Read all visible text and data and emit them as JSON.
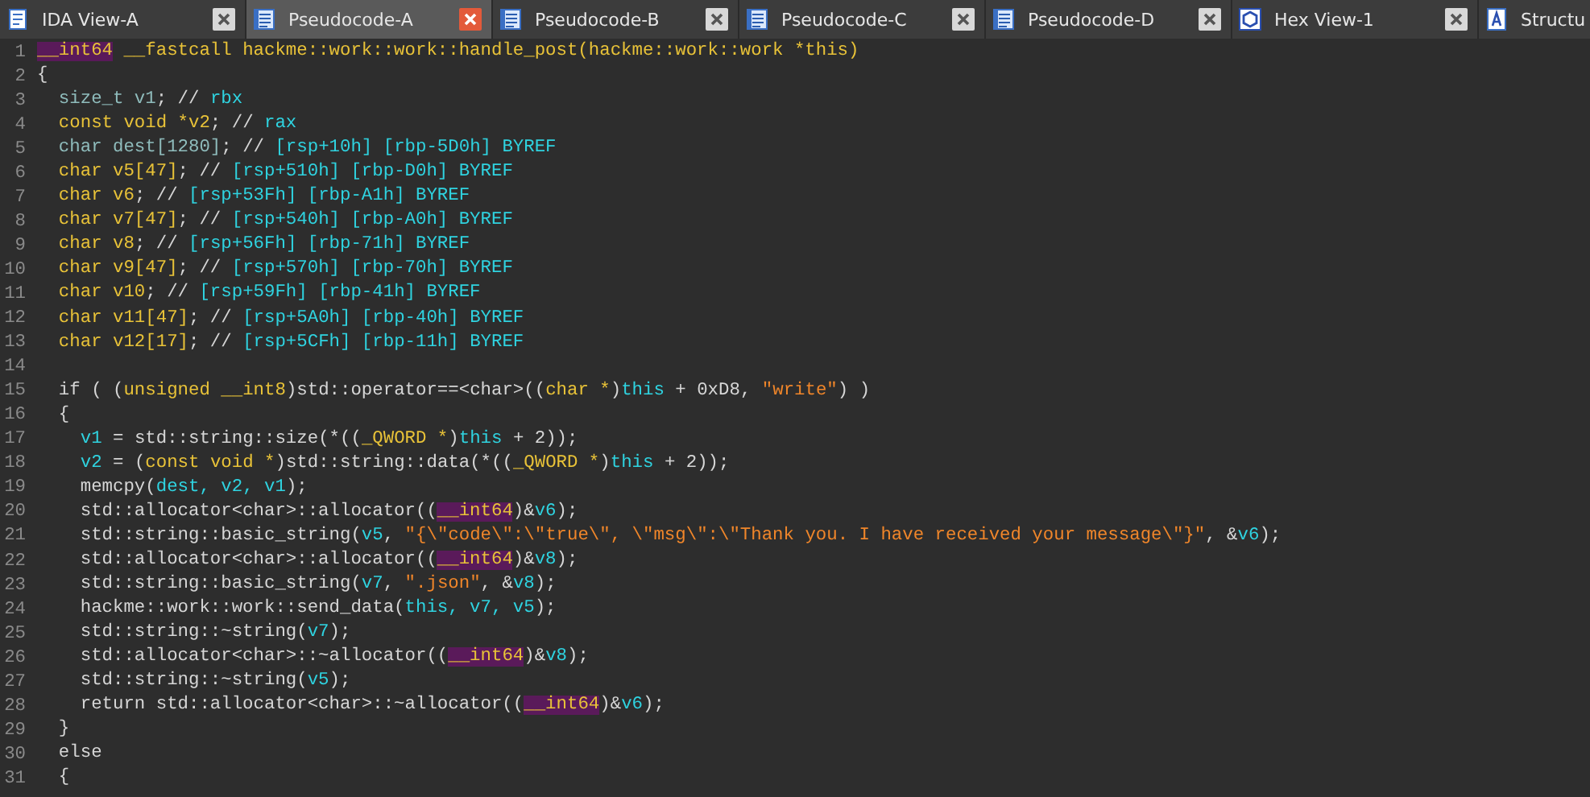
{
  "tabs": [
    {
      "kind": "ida",
      "label": "IDA View-A",
      "selected": false
    },
    {
      "kind": "pseudo",
      "label": "Pseudocode-A",
      "selected": true
    },
    {
      "kind": "pseudo",
      "label": "Pseudocode-B",
      "selected": false
    },
    {
      "kind": "pseudo",
      "label": "Pseudocode-C",
      "selected": false
    },
    {
      "kind": "pseudo",
      "label": "Pseudocode-D",
      "selected": false
    },
    {
      "kind": "hex",
      "label": "Hex View-1",
      "selected": false
    },
    {
      "kind": "struct",
      "label": "Structu",
      "selected": false
    }
  ],
  "code_lines": [
    {
      "n": "1",
      "tokens": [
        {
          "kind": "h",
          "text": "__int64"
        },
        {
          "kind": "k",
          "text": " __fastcall hackme::work::work::handle_post(hackme::work::work *this)"
        }
      ]
    },
    {
      "n": "2",
      "tokens": [
        {
          "kind": "t",
          "text": "{"
        }
      ]
    },
    {
      "n": "3",
      "tokens": [
        {
          "kind": "l",
          "text": "  size_t v1"
        },
        {
          "kind": "t",
          "text": "; // "
        },
        {
          "kind": "v",
          "text": "rbx"
        }
      ]
    },
    {
      "n": "4",
      "tokens": [
        {
          "kind": "k",
          "text": "  const void *v2"
        },
        {
          "kind": "t",
          "text": "; // "
        },
        {
          "kind": "v",
          "text": "rax"
        }
      ]
    },
    {
      "n": "5",
      "tokens": [
        {
          "kind": "l",
          "text": "  char dest[1280]"
        },
        {
          "kind": "t",
          "text": "; // "
        },
        {
          "kind": "v",
          "text": "[rsp+10h] [rbp-5D0h] BYREF"
        }
      ]
    },
    {
      "n": "6",
      "tokens": [
        {
          "kind": "k",
          "text": "  char v5[47]"
        },
        {
          "kind": "t",
          "text": "; // "
        },
        {
          "kind": "v",
          "text": "[rsp+510h] [rbp-D0h] BYREF"
        }
      ]
    },
    {
      "n": "7",
      "tokens": [
        {
          "kind": "k",
          "text": "  char v6"
        },
        {
          "kind": "t",
          "text": "; // "
        },
        {
          "kind": "v",
          "text": "[rsp+53Fh] [rbp-A1h] BYREF"
        }
      ]
    },
    {
      "n": "8",
      "tokens": [
        {
          "kind": "k",
          "text": "  char v7[47]"
        },
        {
          "kind": "t",
          "text": "; // "
        },
        {
          "kind": "v",
          "text": "[rsp+540h] [rbp-A0h] BYREF"
        }
      ]
    },
    {
      "n": "9",
      "tokens": [
        {
          "kind": "k",
          "text": "  char v8"
        },
        {
          "kind": "t",
          "text": "; // "
        },
        {
          "kind": "v",
          "text": "[rsp+56Fh] [rbp-71h] BYREF"
        }
      ]
    },
    {
      "n": "10",
      "tokens": [
        {
          "kind": "k",
          "text": "  char v9[47]"
        },
        {
          "kind": "t",
          "text": "; // "
        },
        {
          "kind": "v",
          "text": "[rsp+570h] [rbp-70h] BYREF"
        }
      ]
    },
    {
      "n": "11",
      "tokens": [
        {
          "kind": "k",
          "text": "  char v10"
        },
        {
          "kind": "t",
          "text": "; // "
        },
        {
          "kind": "v",
          "text": "[rsp+59Fh] [rbp-41h] BYREF"
        }
      ]
    },
    {
      "n": "12",
      "tokens": [
        {
          "kind": "k",
          "text": "  char v11[47]"
        },
        {
          "kind": "t",
          "text": "; // "
        },
        {
          "kind": "v",
          "text": "[rsp+5A0h] [rbp-40h] BYREF"
        }
      ]
    },
    {
      "n": "13",
      "tokens": [
        {
          "kind": "k",
          "text": "  char v12[17]"
        },
        {
          "kind": "t",
          "text": "; // "
        },
        {
          "kind": "v",
          "text": "[rsp+5CFh] [rbp-11h] BYREF"
        }
      ]
    },
    {
      "n": "14"
    },
    {
      "n": "15",
      "tokens": [
        {
          "kind": "t",
          "text": "  if ( ("
        },
        {
          "kind": "k",
          "text": "unsigned __int8"
        },
        {
          "kind": "t",
          "text": ")std::operator==<char>(("
        },
        {
          "kind": "k",
          "text": "char *"
        },
        {
          "kind": "t",
          "text": ")"
        },
        {
          "kind": "v",
          "text": "this"
        },
        {
          "kind": "t",
          "text": " + 0xD8, "
        },
        {
          "kind": "s",
          "text": "\"write\""
        },
        {
          "kind": "t",
          "text": ") )"
        }
      ]
    },
    {
      "n": "16",
      "tokens": [
        {
          "kind": "t",
          "text": "  {"
        }
      ]
    },
    {
      "n": "17",
      "tokens": [
        {
          "kind": "v",
          "text": "    v1"
        },
        {
          "kind": "t",
          "text": " = std::string::size(*(("
        },
        {
          "kind": "k",
          "text": "_QWORD *"
        },
        {
          "kind": "t",
          "text": ")"
        },
        {
          "kind": "v",
          "text": "this"
        },
        {
          "kind": "t",
          "text": " + 2));"
        }
      ]
    },
    {
      "n": "18",
      "tokens": [
        {
          "kind": "v",
          "text": "    v2"
        },
        {
          "kind": "t",
          "text": " = ("
        },
        {
          "kind": "k",
          "text": "const void *"
        },
        {
          "kind": "t",
          "text": ")std::string::data(*(("
        },
        {
          "kind": "k",
          "text": "_QWORD *"
        },
        {
          "kind": "t",
          "text": ")"
        },
        {
          "kind": "v",
          "text": "this"
        },
        {
          "kind": "t",
          "text": " + 2));"
        }
      ]
    },
    {
      "n": "19",
      "tokens": [
        {
          "kind": "t",
          "text": "    memcpy("
        },
        {
          "kind": "v",
          "text": "dest, v2, v1"
        },
        {
          "kind": "t",
          "text": ");"
        }
      ]
    },
    {
      "n": "20",
      "tokens": [
        {
          "kind": "t",
          "text": "    std::allocator<char>::allocator(("
        },
        {
          "kind": "h",
          "text": "__int64"
        },
        {
          "kind": "t",
          "text": ")&"
        },
        {
          "kind": "v",
          "text": "v6"
        },
        {
          "kind": "t",
          "text": ");"
        }
      ]
    },
    {
      "n": "21",
      "tokens": [
        {
          "kind": "t",
          "text": "    std::string::basic_string("
        },
        {
          "kind": "v",
          "text": "v5"
        },
        {
          "kind": "t",
          "text": ", "
        },
        {
          "kind": "s",
          "text": "\"{\\\"code\\\":\\\"true\\\", \\\"msg\\\":\\\"Thank you. I have received your message\\\"}\""
        },
        {
          "kind": "t",
          "text": ", &"
        },
        {
          "kind": "v",
          "text": "v6"
        },
        {
          "kind": "t",
          "text": ");"
        }
      ]
    },
    {
      "n": "22",
      "tokens": [
        {
          "kind": "t",
          "text": "    std::allocator<char>::allocator(("
        },
        {
          "kind": "h",
          "text": "__int64"
        },
        {
          "kind": "t",
          "text": ")&"
        },
        {
          "kind": "v",
          "text": "v8"
        },
        {
          "kind": "t",
          "text": ");"
        }
      ]
    },
    {
      "n": "23",
      "tokens": [
        {
          "kind": "t",
          "text": "    std::string::basic_string("
        },
        {
          "kind": "v",
          "text": "v7"
        },
        {
          "kind": "t",
          "text": ", "
        },
        {
          "kind": "s",
          "text": "\".json\""
        },
        {
          "kind": "t",
          "text": ", &"
        },
        {
          "kind": "v",
          "text": "v8"
        },
        {
          "kind": "t",
          "text": ");"
        }
      ]
    },
    {
      "n": "24",
      "tokens": [
        {
          "kind": "t",
          "text": "    hackme::work::work::send_data("
        },
        {
          "kind": "v",
          "text": "this, v7, v5"
        },
        {
          "kind": "t",
          "text": ");"
        }
      ]
    },
    {
      "n": "25",
      "tokens": [
        {
          "kind": "t",
          "text": "    std::string::~string("
        },
        {
          "kind": "v",
          "text": "v7"
        },
        {
          "kind": "t",
          "text": ");"
        }
      ]
    },
    {
      "n": "26",
      "tokens": [
        {
          "kind": "t",
          "text": "    std::allocator<char>::~allocator(("
        },
        {
          "kind": "h",
          "text": "__int64"
        },
        {
          "kind": "t",
          "text": ")&"
        },
        {
          "kind": "v",
          "text": "v8"
        },
        {
          "kind": "t",
          "text": ");"
        }
      ]
    },
    {
      "n": "27",
      "tokens": [
        {
          "kind": "t",
          "text": "    std::string::~string("
        },
        {
          "kind": "v",
          "text": "v5"
        },
        {
          "kind": "t",
          "text": ");"
        }
      ]
    },
    {
      "n": "28",
      "tokens": [
        {
          "kind": "t",
          "text": "    return std::allocator<char>::~allocator(("
        },
        {
          "kind": "h",
          "text": "__int64"
        },
        {
          "kind": "t",
          "text": ")&"
        },
        {
          "kind": "v",
          "text": "v6"
        },
        {
          "kind": "t",
          "text": ");"
        }
      ]
    },
    {
      "n": "29",
      "tokens": [
        {
          "kind": "t",
          "text": "  }"
        }
      ]
    },
    {
      "n": "30",
      "tokens": [
        {
          "kind": "t",
          "text": "  else"
        }
      ]
    },
    {
      "n": "31",
      "tokens": [
        {
          "kind": "t",
          "text": "  {"
        }
      ]
    }
  ]
}
